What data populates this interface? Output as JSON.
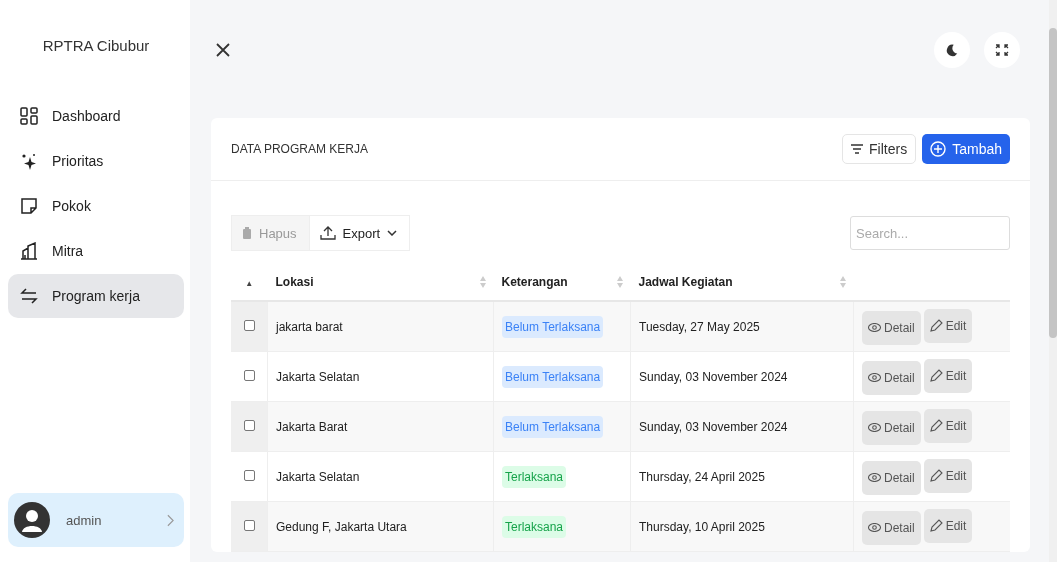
{
  "sidebar": {
    "brand": "RPTRA Cibubur",
    "items": [
      {
        "label": "Dashboard",
        "selected": false
      },
      {
        "label": "Prioritas",
        "selected": false
      },
      {
        "label": "Pokok",
        "selected": false
      },
      {
        "label": "Mitra",
        "selected": false
      },
      {
        "label": "Program kerja",
        "selected": true
      }
    ],
    "user": {
      "name": "admin"
    }
  },
  "card": {
    "title": "DATA PROGRAM KERJA",
    "filters": "Filters",
    "add": "Tambah",
    "delete": "Hapus",
    "export": "Export",
    "search": {
      "placeholder": "Search..."
    },
    "table": {
      "sort_mark": "▲",
      "columns": [
        "Lokasi",
        "Keterangan",
        "Jadwal Kegiatan"
      ],
      "rows": [
        {
          "checked": false,
          "lokasi": "jakarta barat",
          "status": {
            "kind": "pending",
            "label": "Belum Terlaksana"
          },
          "jadwal": "Tuesday, 27 May 2025",
          "detail": "Detail",
          "edit": "Edit"
        },
        {
          "checked": false,
          "lokasi": "Jakarta Selatan",
          "status": {
            "kind": "pending",
            "label": "Belum Terlaksana"
          },
          "jadwal": "Sunday, 03 November 2024",
          "detail": "Detail",
          "edit": "Edit"
        },
        {
          "checked": false,
          "lokasi": "Jakarta Barat",
          "status": {
            "kind": "pending",
            "label": "Belum Terlaksana"
          },
          "jadwal": "Sunday, 03 November 2024",
          "detail": "Detail",
          "edit": "Edit"
        },
        {
          "checked": false,
          "lokasi": "Jakarta Selatan",
          "status": {
            "kind": "done",
            "label": "Terlaksana"
          },
          "jadwal": "Thursday, 24 April 2025",
          "detail": "Detail",
          "edit": "Edit"
        },
        {
          "checked": false,
          "lokasi": "Gedung F, Jakarta Utara",
          "status": {
            "kind": "done",
            "label": "Terlaksana"
          },
          "jadwal": "Thursday, 10 April 2025",
          "detail": "Detail",
          "edit": "Edit"
        }
      ]
    }
  }
}
